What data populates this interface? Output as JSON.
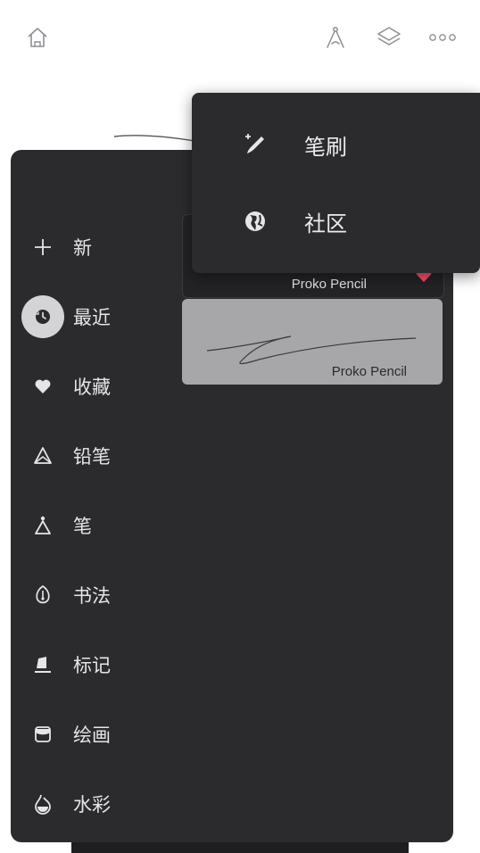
{
  "toolbar": {
    "icons": [
      "home-icon",
      "compass-icon",
      "layers-icon",
      "more-icon"
    ]
  },
  "library": {
    "categories": [
      {
        "label": "新",
        "icon": "plus-icon"
      },
      {
        "label": "最近",
        "icon": "history-icon",
        "active": true
      },
      {
        "label": "收藏",
        "icon": "heart-icon"
      },
      {
        "label": "铅笔",
        "icon": "pencil-icon"
      },
      {
        "label": "笔",
        "icon": "pen-icon"
      },
      {
        "label": "书法",
        "icon": "calligraphy-icon"
      },
      {
        "label": "标记",
        "icon": "marker-icon"
      },
      {
        "label": "绘画",
        "icon": "paint-icon"
      },
      {
        "label": "水彩",
        "icon": "watercolor-icon"
      }
    ],
    "brushes": [
      {
        "name": "Proko Pencil",
        "favorited": true
      },
      {
        "name": "Proko Pencil",
        "favorited": false
      }
    ]
  },
  "popover": {
    "items": [
      {
        "label": "笔刷",
        "icon": "brush-sparkle-icon"
      },
      {
        "label": "社区",
        "icon": "globe-icon"
      }
    ]
  },
  "colors": {
    "panel": "#2b2b2e",
    "favorite": "#ff4d6a",
    "selected_card": "#a7a7aa"
  }
}
